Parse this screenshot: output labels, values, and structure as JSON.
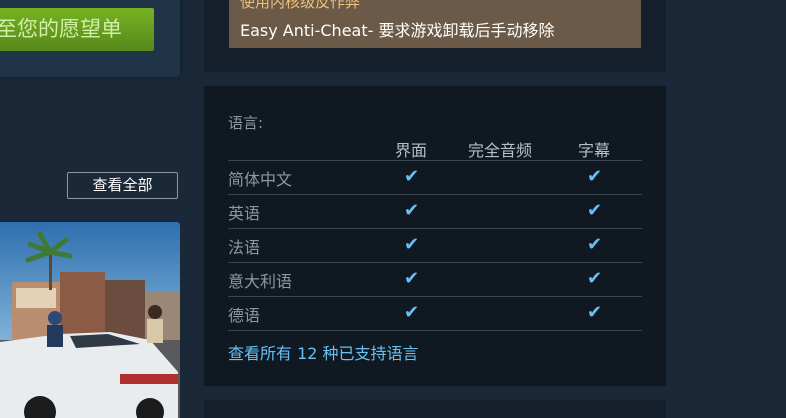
{
  "wishlist": {
    "button_label": "至您的愿望单"
  },
  "screenshots": {
    "view_all_label": "查看全部"
  },
  "anticheat": {
    "title": "使用内核级反作弊",
    "text": "Easy Anti-Cheat- 要求游戏卸载后手动移除"
  },
  "languages": {
    "header": "语言:",
    "columns": [
      "界面",
      "完全音频",
      "字幕"
    ],
    "rows": [
      {
        "name": "简体中文",
        "interface": true,
        "full_audio": false,
        "subtitles": true
      },
      {
        "name": "英语",
        "interface": true,
        "full_audio": false,
        "subtitles": true
      },
      {
        "name": "法语",
        "interface": true,
        "full_audio": false,
        "subtitles": true
      },
      {
        "name": "意大利语",
        "interface": true,
        "full_audio": false,
        "subtitles": true
      },
      {
        "name": "德语",
        "interface": true,
        "full_audio": false,
        "subtitles": true
      }
    ],
    "check_glyph": "✔",
    "view_all_link": "查看所有 12 种已支持语言"
  },
  "colors": {
    "background": "#1b2838",
    "accent_link": "#67c1f5",
    "wishlist_green": "#75b022",
    "anticheat_bg": "#6b5a47"
  }
}
